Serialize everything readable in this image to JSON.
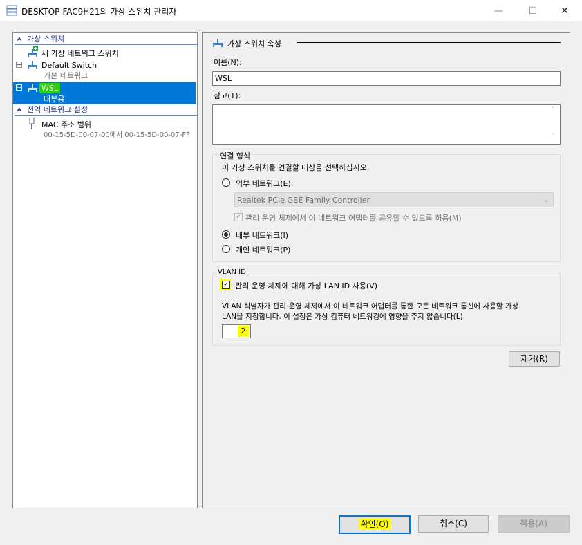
{
  "window": {
    "title": "DESKTOP-FAC9H21의 가상 스위치 관리자",
    "minimize": "—",
    "maximize": "☐",
    "close": "✕"
  },
  "left_pane": {
    "section_switches": "가상 스위치",
    "new_switch": "새 가상 네트워크 스위치",
    "switches": [
      {
        "name": "Default Switch",
        "type": "기본 네트워크"
      },
      {
        "name": "WSL",
        "type": "내부용"
      }
    ],
    "section_global": "전역 네트워크 설정",
    "mac_title": "MAC 주소 범위",
    "mac_range": "00-15-5D-00-07-00에서 00-15-5D-00-07-FF"
  },
  "right_pane": {
    "header": "가상 스위치 속성",
    "name_label": "이름(N):",
    "name_value": "WSL",
    "notes_label": "참고(T):",
    "notes_value": "",
    "connection": {
      "legend": "연결 형식",
      "instruction": "이 가상 스위치를 연결할 대상을 선택하십시오.",
      "external_label": "외부 네트워크(E):",
      "adapter": "Realtek PCIe GBE Family Controller",
      "share_label": "관리 운영 체제에서 이 네트워크 어댑터를 공유할 수 있도록 허용(M)",
      "internal_label": "내부 네트워크(I)",
      "private_label": "개인 네트워크(P)",
      "selected": "internal"
    },
    "vlan": {
      "legend": "VLAN ID",
      "enable_label": "관리 운영 체제에 대해 가상 LAN ID 사용(V)",
      "enabled": true,
      "description_line1": "VLAN 식별자가 관리 운영 체제에서 이 네트워크 어댑터를 통한 모든 네트워크 통신에 사용할 가상",
      "description_line2": "LAN을 지정합니다. 이 설정은 가상 컴퓨터 네트워킹에 영향을 주지 않습니다(L).",
      "id_value": "2"
    },
    "remove_button": "제거(R)"
  },
  "footer": {
    "ok": "확인(O)",
    "cancel": "취소(C)",
    "apply": "적용(A)"
  },
  "colors": {
    "selection": "#0078d7",
    "highlight_yellow": "#ffff00",
    "highlight_green": "#2ad400",
    "section_blue": "#1e3287"
  }
}
